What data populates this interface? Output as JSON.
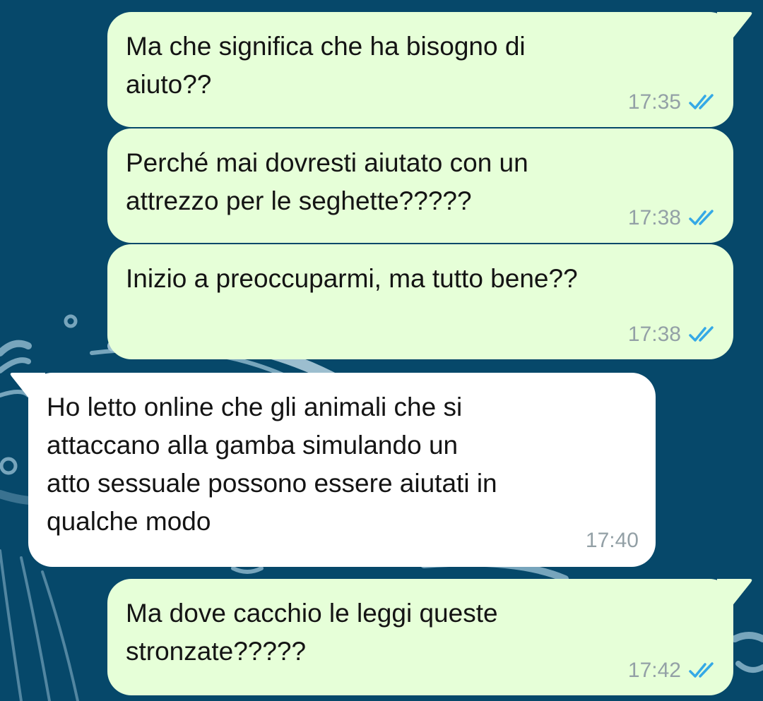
{
  "theme": {
    "background": "#06486a",
    "outgoing_bubble": "#e6ffd8",
    "incoming_bubble": "#ffffff",
    "read_ticks": "#35a9e6",
    "time_color": "#93a0a6"
  },
  "messages": [
    {
      "direction": "outgoing",
      "text": "Ma che significa che ha bisogno di\naiuto??",
      "time": "17:35",
      "status": "read",
      "status_icon": "double-check-icon"
    },
    {
      "direction": "outgoing",
      "text": "Perché mai dovresti aiutato con un\nattrezzo per le seghette?????",
      "time": "17:38",
      "status": "read",
      "status_icon": "double-check-icon"
    },
    {
      "direction": "outgoing",
      "text": "Inizio a preoccuparmi, ma tutto bene??",
      "time": "17:38",
      "status": "read",
      "status_icon": "double-check-icon"
    },
    {
      "direction": "incoming",
      "text": "Ho letto online che gli animali che si\nattaccano alla gamba simulando un\natto sessuale possono essere aiutati in\nqualche modo",
      "time": "17:40"
    },
    {
      "direction": "outgoing",
      "text": "Ma dove cacchio le leggi queste\nstronzate?????",
      "time": "17:42",
      "status": "read",
      "status_icon": "double-check-icon"
    }
  ]
}
